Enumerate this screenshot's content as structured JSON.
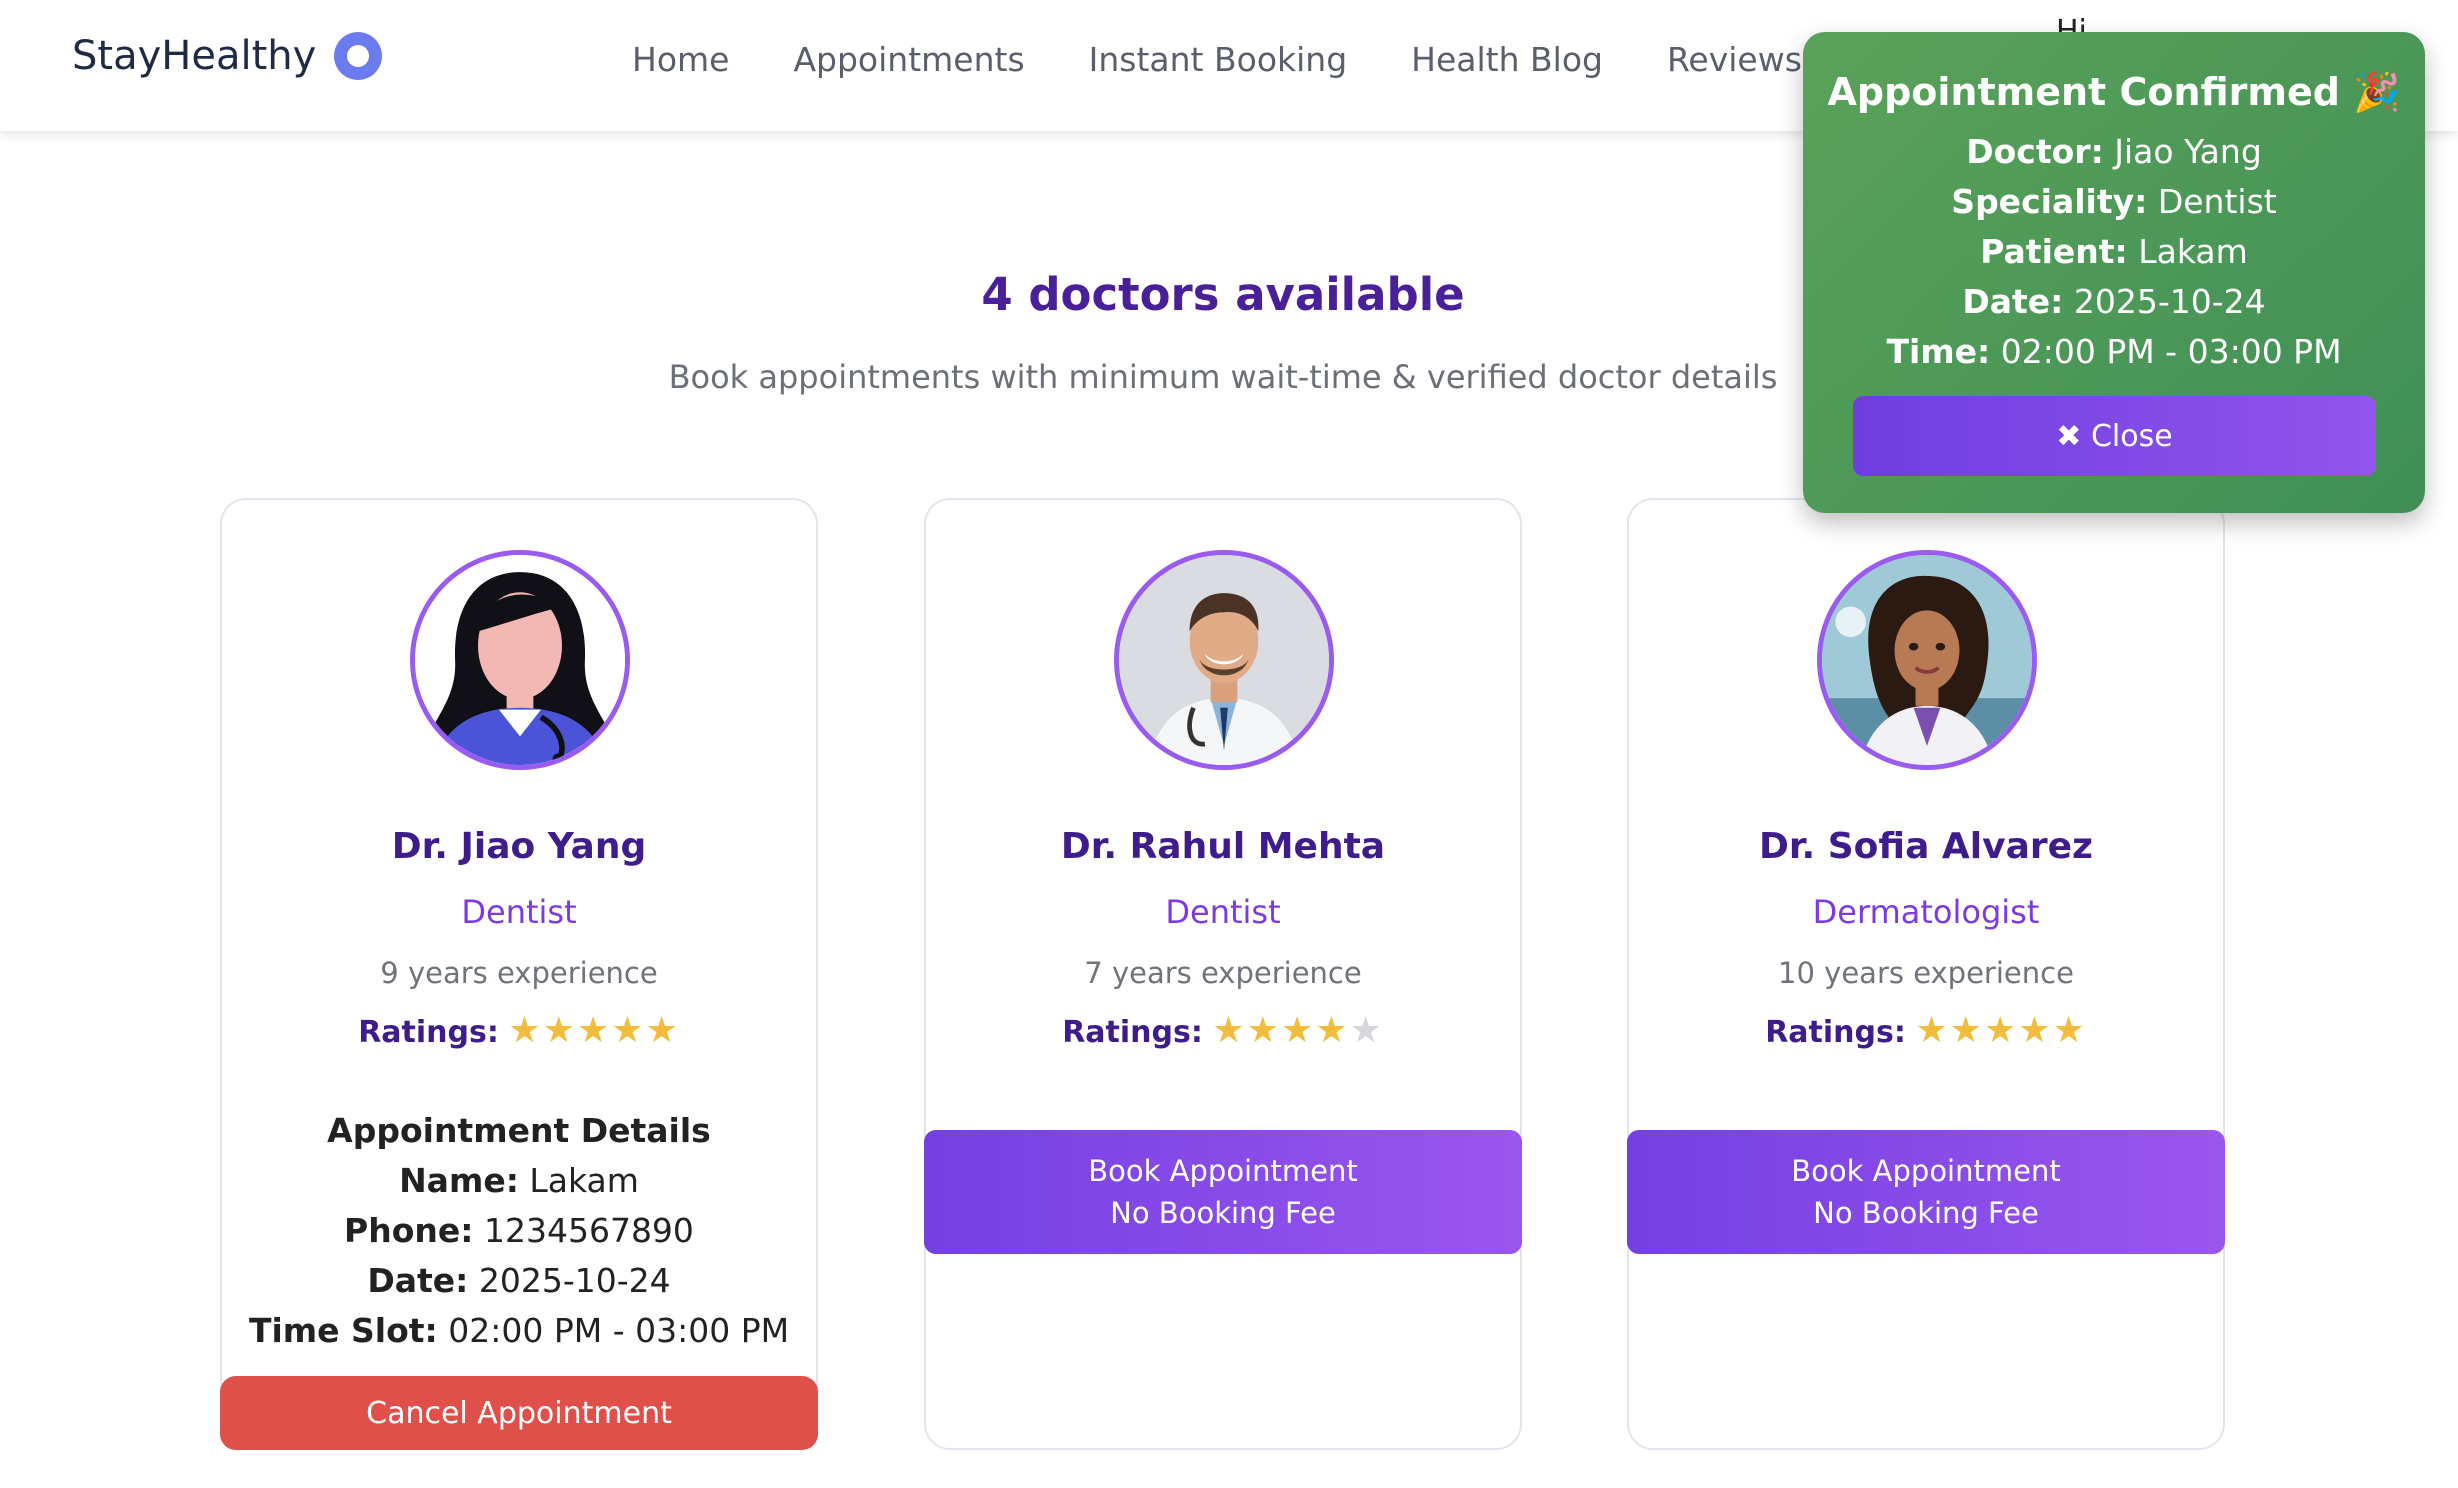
{
  "nav": {
    "brand": "StayHealthy",
    "links": [
      "Home",
      "Appointments",
      "Instant Booking",
      "Health Blog",
      "Reviews"
    ],
    "user_greeting": "Hi"
  },
  "page": {
    "heading": "4 doctors available",
    "subheading": "Book appointments with minimum wait-time & verified doctor details"
  },
  "labels": {
    "ratings": "Ratings:",
    "appt_title": "Appointment Details",
    "name": "Name:",
    "phone": "Phone:",
    "date": "Date:",
    "time_slot": "Time Slot:",
    "cancel": "Cancel Appointment",
    "book_line1": "Book Appointment",
    "book_line2": "No Booking Fee"
  },
  "doctors": [
    {
      "name": "Dr. Jiao Yang",
      "speciality": "Dentist",
      "experience": "9 years experience",
      "rating": 5
    },
    {
      "name": "Dr. Rahul Mehta",
      "speciality": "Dentist",
      "experience": "7 years experience",
      "rating": 4
    },
    {
      "name": "Dr. Sofia Alvarez",
      "speciality": "Dermatologist",
      "experience": "10 years experience",
      "rating": 5
    }
  ],
  "appointment": {
    "name": "Lakam",
    "phone": "1234567890",
    "date": "2025-10-24",
    "time_slot": "02:00 PM - 03:00 PM"
  },
  "toast": {
    "title": "Appointment Confirmed 🎉",
    "doctor_label": "Doctor:",
    "doctor": "Jiao Yang",
    "speciality_label": "Speciality:",
    "speciality": "Dentist",
    "patient_label": "Patient:",
    "patient": "Lakam",
    "date_label": "Date:",
    "date": "2025-10-24",
    "time_label": "Time:",
    "time": "02:00 PM - 03:00 PM",
    "close": "✖ Close"
  },
  "colors": {
    "accent": "#7b3ae6",
    "heading": "#4a1f9a",
    "toast_bg": "#4f9a58",
    "cancel": "#df504b",
    "star": "#f1bd3a"
  }
}
